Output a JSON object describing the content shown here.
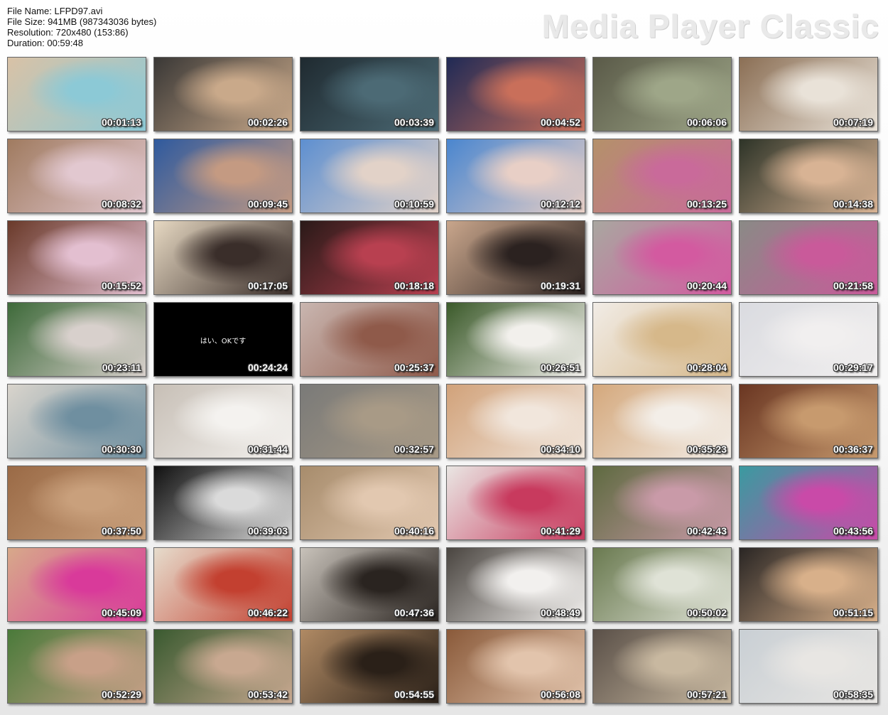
{
  "file_info": {
    "name": "File Name: LFPD97.avi",
    "size": "File Size: 941MB (987343036 bytes)",
    "resolution": "Resolution: 720x480 (153:86)",
    "duration": "Duration: 00:59:48"
  },
  "brand": "Media Player Classic",
  "thumbnails": [
    {
      "time": "00:01:13",
      "colors": [
        "#d9c2a6",
        "#8cc9d6"
      ]
    },
    {
      "time": "00:02:26",
      "colors": [
        "#3a3836",
        "#c9a98a"
      ]
    },
    {
      "time": "00:03:39",
      "colors": [
        "#1f2a30",
        "#4c6a75"
      ]
    },
    {
      "time": "00:04:52",
      "colors": [
        "#202a55",
        "#c96f5a"
      ]
    },
    {
      "time": "00:06:06",
      "colors": [
        "#5a5a48",
        "#9ea688"
      ]
    },
    {
      "time": "00:07:19",
      "colors": [
        "#8b6f55",
        "#e9e2d8"
      ]
    },
    {
      "time": "00:08:32",
      "colors": [
        "#a07b60",
        "#e2c8d0"
      ]
    },
    {
      "time": "00:09:45",
      "colors": [
        "#2f5a9e",
        "#c49a82"
      ]
    },
    {
      "time": "00:10:59",
      "colors": [
        "#5d8fd0",
        "#e2d2c8"
      ]
    },
    {
      "time": "00:12:12",
      "colors": [
        "#4a86cf",
        "#e8cfc6"
      ]
    },
    {
      "time": "00:13:25",
      "colors": [
        "#b4916a",
        "#c96a9a"
      ]
    },
    {
      "time": "00:14:38",
      "colors": [
        "#2e3428",
        "#d8b394"
      ]
    },
    {
      "time": "00:15:52",
      "colors": [
        "#6a3a2a",
        "#e3bfd0"
      ]
    },
    {
      "time": "00:17:05",
      "colors": [
        "#e6d8c2",
        "#3a2e2a"
      ]
    },
    {
      "time": "00:18:18",
      "colors": [
        "#2a1a18",
        "#b84050"
      ]
    },
    {
      "time": "00:19:31",
      "colors": [
        "#c9a68c",
        "#2b2220"
      ]
    },
    {
      "time": "00:20:44",
      "colors": [
        "#a9a7a0",
        "#d35aa0"
      ]
    },
    {
      "time": "00:21:58",
      "colors": [
        "#8a8a86",
        "#c95a9a"
      ]
    },
    {
      "time": "00:23:11",
      "colors": [
        "#3e6a3a",
        "#d8d0cc"
      ]
    },
    {
      "time": "00:24:24",
      "colors": [
        "#000000",
        "#000000"
      ],
      "caption": "はい、OKです"
    },
    {
      "time": "00:25:37",
      "colors": [
        "#c9b6b0",
        "#8f5a4a"
      ]
    },
    {
      "time": "00:26:51",
      "colors": [
        "#3b5a2a",
        "#f2f0ec"
      ]
    },
    {
      "time": "00:28:04",
      "colors": [
        "#f1ece6",
        "#d6b88a"
      ]
    },
    {
      "time": "00:29:17",
      "colors": [
        "#dadbe0",
        "#f1efef"
      ]
    },
    {
      "time": "00:30:30",
      "colors": [
        "#d9d4cc",
        "#6f8fa0"
      ]
    },
    {
      "time": "00:31:44",
      "colors": [
        "#c7bfb6",
        "#f4f2ef"
      ]
    },
    {
      "time": "00:32:57",
      "colors": [
        "#7a7a78",
        "#a89a86"
      ]
    },
    {
      "time": "00:34:10",
      "colors": [
        "#d1a27a",
        "#f1e6dc"
      ]
    },
    {
      "time": "00:35:23",
      "colors": [
        "#d4a87c",
        "#f3eee8"
      ]
    },
    {
      "time": "00:36:37",
      "colors": [
        "#6a3622",
        "#c79a6e"
      ]
    },
    {
      "time": "00:37:50",
      "colors": [
        "#9a6a46",
        "#c9a07c"
      ]
    },
    {
      "time": "00:39:03",
      "colors": [
        "#111111",
        "#dadada"
      ]
    },
    {
      "time": "00:40:16",
      "colors": [
        "#a78c6c",
        "#e2c8b0"
      ]
    },
    {
      "time": "00:41:29",
      "colors": [
        "#e9e6e3",
        "#c83a5e"
      ]
    },
    {
      "time": "00:42:43",
      "colors": [
        "#5e6a40",
        "#c99aa8"
      ]
    },
    {
      "time": "00:43:56",
      "colors": [
        "#3a9aa0",
        "#c94aa8"
      ]
    },
    {
      "time": "00:45:09",
      "colors": [
        "#d7a98a",
        "#d93a9a"
      ]
    },
    {
      "time": "00:46:22",
      "colors": [
        "#e6dccc",
        "#c34030"
      ]
    },
    {
      "time": "00:47:36",
      "colors": [
        "#c8c2ba",
        "#2a2420"
      ]
    },
    {
      "time": "00:48:49",
      "colors": [
        "#4a4540",
        "#f2f0ee"
      ]
    },
    {
      "time": "00:50:02",
      "colors": [
        "#6a7a50",
        "#dfe2d6"
      ]
    },
    {
      "time": "00:51:15",
      "colors": [
        "#2a2624",
        "#d8b08a"
      ]
    },
    {
      "time": "00:52:29",
      "colors": [
        "#4a7a3a",
        "#c8a088"
      ]
    },
    {
      "time": "00:53:42",
      "colors": [
        "#3a5a30",
        "#c8a890"
      ]
    },
    {
      "time": "00:54:55",
      "colors": [
        "#b08a64",
        "#2a2018"
      ]
    },
    {
      "time": "00:56:08",
      "colors": [
        "#8a5a3a",
        "#e2c4ac"
      ]
    },
    {
      "time": "00:57:21",
      "colors": [
        "#5a5048",
        "#c8b8a0"
      ]
    },
    {
      "time": "00:58:35",
      "colors": [
        "#c9cfd4",
        "#e8e6e3"
      ]
    }
  ]
}
